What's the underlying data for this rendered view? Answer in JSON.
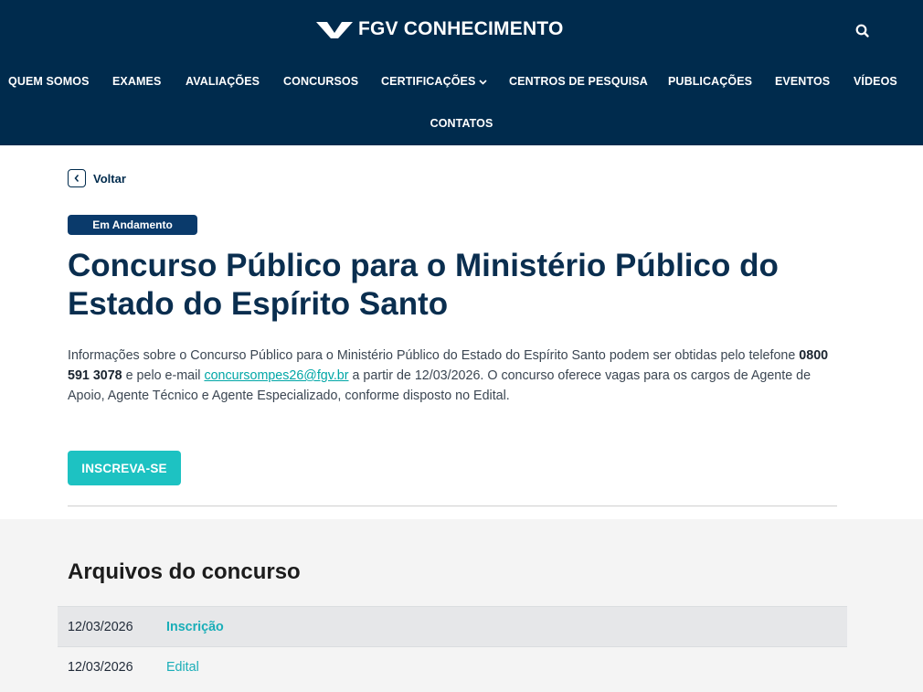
{
  "header": {
    "logo_text": "FGV CONHECIMENTO",
    "brand_color": "#002b4d",
    "nav": [
      {
        "label": "QUEM SOMOS"
      },
      {
        "label": "EXAMES"
      },
      {
        "label": "AVALIAÇÕES"
      },
      {
        "label": "CONCURSOS"
      },
      {
        "label": "CERTIFICAÇÕES",
        "icon": "chevron-down-icon"
      },
      {
        "label": "CENTROS DE PESQUISA"
      },
      {
        "label": "PUBLICAÇÕES"
      },
      {
        "label": "EVENTOS"
      },
      {
        "label": "VÍDEOS"
      },
      {
        "label": "CONTATOS"
      }
    ],
    "search_icon": "search-icon"
  },
  "page": {
    "back_label": "Voltar",
    "status_badge": "Em Andamento",
    "title": "Concurso Público para o Ministério Público do Estado do Espírito Santo",
    "description": {
      "part1": "Informações sobre o Concurso Público para o Ministério Público do Estado do Espírito Santo podem ser obtidas pelo telefone ",
      "phone": "0800 591 3078",
      "part2": " e pelo e-mail ",
      "email": "concursompes26@fgv.br",
      "part3": " a partir de 12/03/2026. O concurso oferece vagas para os cargos de Agente de Apoio, Agente Técnico e Agente Especializado, conforme disposto no Edital."
    },
    "cta_label": "INSCREVA-SE",
    "accent_color": "#1dc2c2"
  },
  "files": {
    "title": "Arquivos do concurso",
    "rows": [
      {
        "date": "12/03/2026",
        "name": "Inscrição"
      },
      {
        "date": "12/03/2026",
        "name": "Edital"
      }
    ]
  }
}
